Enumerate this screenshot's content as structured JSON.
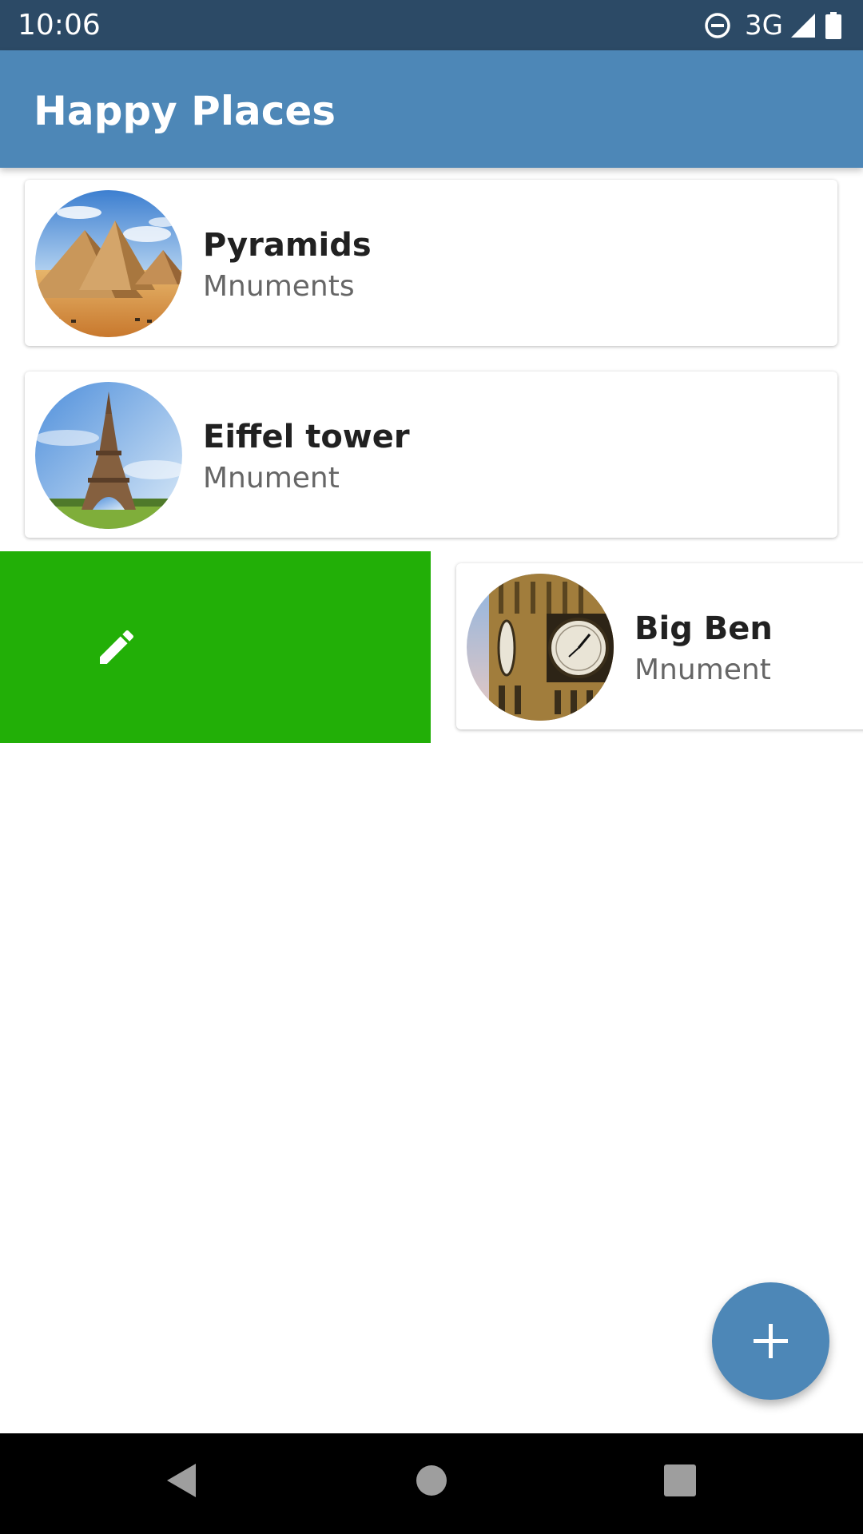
{
  "status_bar": {
    "time": "10:06",
    "network": "3G",
    "icons": [
      "do-not-disturb-icon",
      "signal-icon",
      "battery-icon"
    ]
  },
  "app_bar": {
    "title": "Happy Places",
    "color": "#4d87b7"
  },
  "places": [
    {
      "title": "Pyramids",
      "subtitle": "Mnuments",
      "thumbnail": "pyramids-photo"
    },
    {
      "title": "Eiffel tower",
      "subtitle": "Mnument",
      "thumbnail": "eiffel-tower-photo"
    },
    {
      "title": "Big Ben",
      "subtitle": "Mnument",
      "thumbnail": "big-ben-photo",
      "state": "swiped-right"
    }
  ],
  "swipe_action": {
    "icon": "edit-icon",
    "color": "#22af07"
  },
  "fab": {
    "icon": "add-icon"
  },
  "nav_bar": {
    "buttons": [
      "back-icon",
      "home-icon",
      "recents-icon"
    ]
  }
}
